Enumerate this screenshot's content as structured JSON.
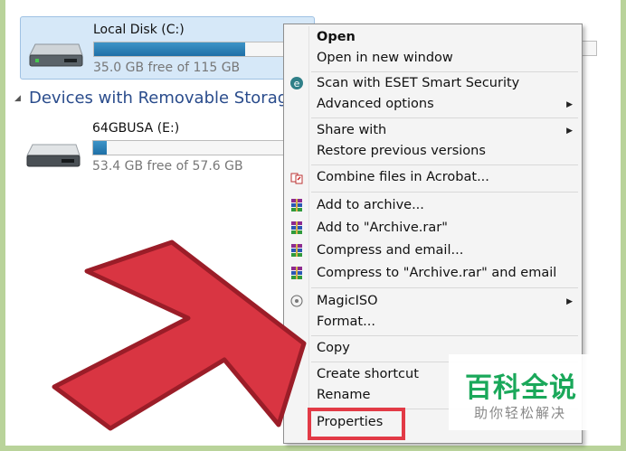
{
  "drives": [
    {
      "name": "Local Disk (C:)",
      "free_text": "35.0 GB free of 115 GB",
      "used_fraction": 0.7,
      "selected": true
    },
    {
      "name": "64GBUSA (E:)",
      "free_text": "53.4 GB free of 57.6 GB",
      "used_fraction": 0.07,
      "selected": false
    }
  ],
  "section_title": "Devices with Removable Storage (",
  "context_menu": {
    "items": [
      {
        "label": "Open",
        "bold": true
      },
      {
        "label": "Open in new window"
      },
      {
        "label": "Scan with ESET Smart Security",
        "icon": "eset-icon"
      },
      {
        "label": "Advanced options",
        "submenu": true
      },
      {
        "label": "Share with",
        "submenu": true
      },
      {
        "label": "Restore previous versions"
      },
      {
        "label": "Combine files in Acrobat...",
        "icon": "acrobat-icon"
      },
      {
        "label": "Add to archive...",
        "icon": "winrar-icon"
      },
      {
        "label": "Add to \"Archive.rar\"",
        "icon": "winrar-icon"
      },
      {
        "label": "Compress and email...",
        "icon": "winrar-icon"
      },
      {
        "label": "Compress to \"Archive.rar\" and email",
        "icon": "winrar-icon"
      },
      {
        "label": "MagicISO",
        "icon": "magiciso-icon",
        "submenu": true
      },
      {
        "label": "Format..."
      },
      {
        "label": "Copy"
      },
      {
        "label": "Create shortcut"
      },
      {
        "label": "Rename"
      },
      {
        "label": "Properties",
        "highlighted": true
      }
    ]
  },
  "watermark": {
    "main": "百科全说",
    "sub": "助你轻松解决"
  },
  "colors": {
    "accent_red": "#e23a46",
    "bar_fill": "#2a7fb8",
    "section_blue": "#2a4c8c",
    "watermark_green": "#1aa85a",
    "background_green": "#b9d39a"
  }
}
